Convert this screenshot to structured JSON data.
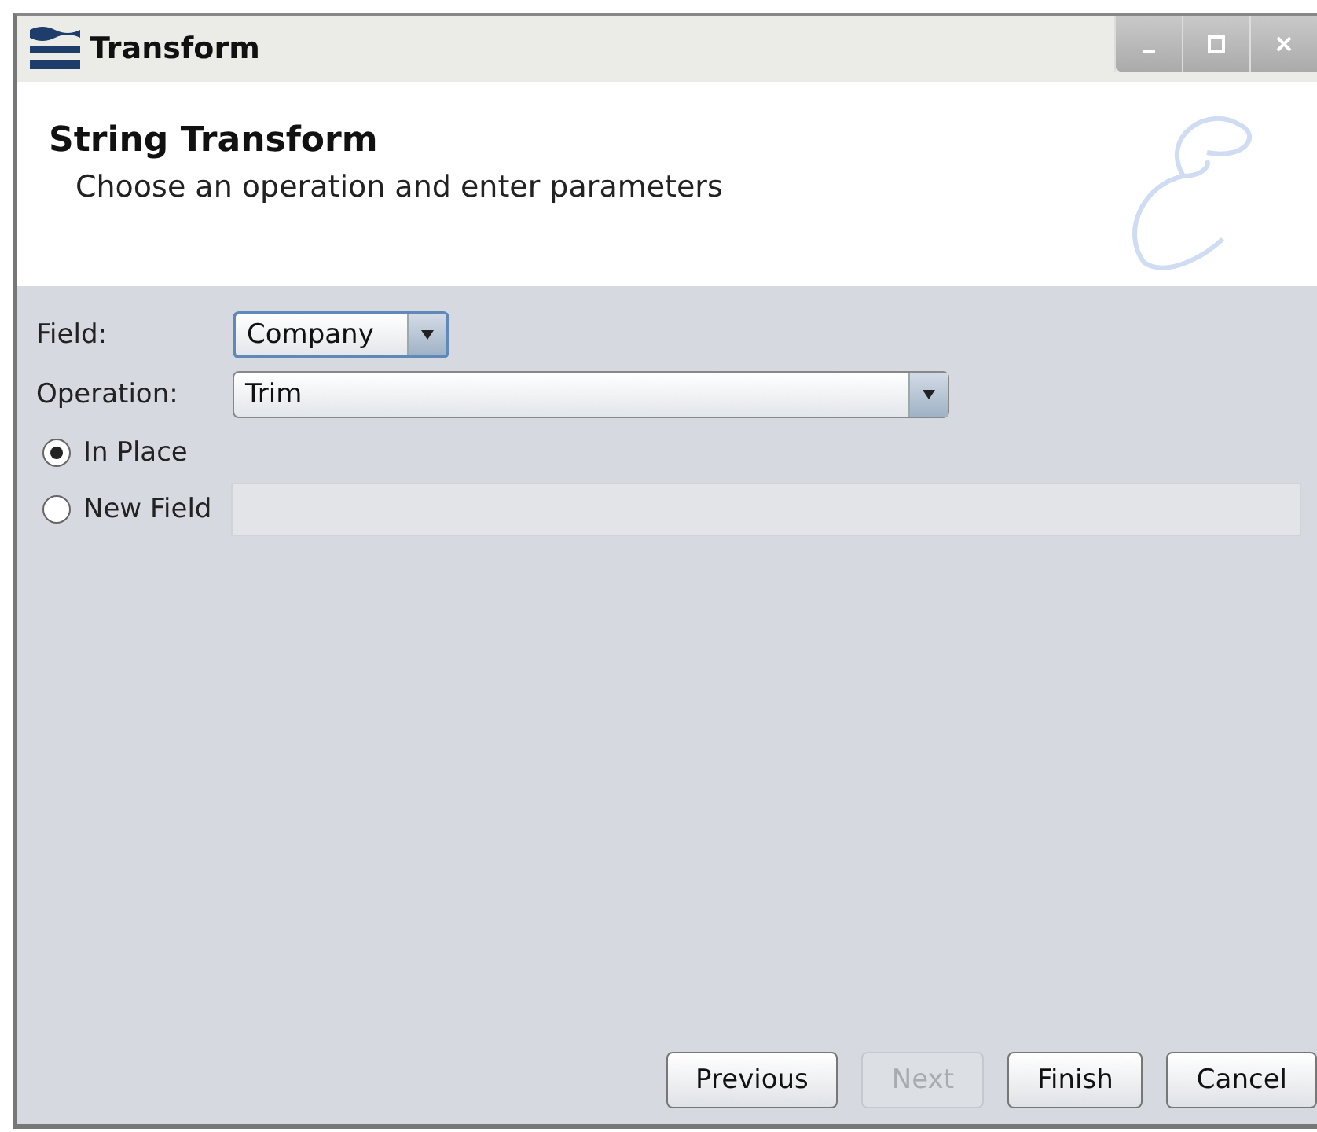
{
  "window": {
    "title": "Transform"
  },
  "header": {
    "title": "String Transform",
    "subtitle": "Choose an operation and enter parameters"
  },
  "field": {
    "label": "Field:",
    "value": "Company",
    "focused": true
  },
  "operation": {
    "label": "Operation:",
    "value": "Trim"
  },
  "targets": [
    {
      "label": "In Place",
      "selected": true
    },
    {
      "label": "New Field",
      "selected": false,
      "has_input": true
    }
  ],
  "buttons": [
    {
      "label": "Previous",
      "disabled": false
    },
    {
      "label": "Next",
      "disabled": true
    },
    {
      "label": "Finish",
      "disabled": false
    },
    {
      "label": "Cancel",
      "disabled": false
    }
  ]
}
